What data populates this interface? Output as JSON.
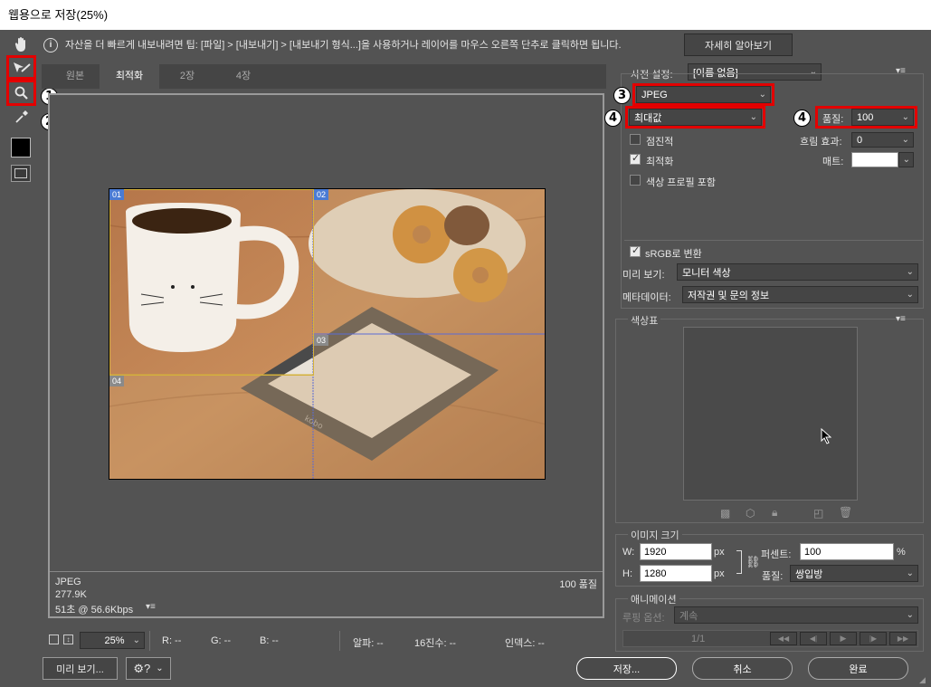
{
  "window": {
    "title": "웹용으로 저장(25%)"
  },
  "tip": {
    "text": "자산을 더 빠르게 내보내려면 팁: [파일] > [내보내기] > [내보내기 형식...]을 사용하거나 레이어를 마우스 오른쪽 단추로 클릭하면 됩니다.",
    "learn_more": "자세히 알아보기"
  },
  "tools": [
    "hand-icon",
    "slice-select-icon",
    "zoom-icon",
    "eyedropper-icon",
    "color-swatch",
    "toggle-slices-icon"
  ],
  "annotations": {
    "b1": "1",
    "b2": "2",
    "b3": "3",
    "b4a": "4",
    "b4b": "4"
  },
  "tabs": [
    {
      "label": "원본"
    },
    {
      "label": "최적화"
    },
    {
      "label": "2장"
    },
    {
      "label": "4장"
    }
  ],
  "slices": {
    "s01": "01",
    "s02": "02",
    "s03": "03",
    "s04": "04"
  },
  "image_info": {
    "format": "JPEG",
    "size": "277.9K",
    "time": "51초 @ 56.6Kbps",
    "quality": "100 품질"
  },
  "preset": {
    "label": "사전 설정:",
    "value": "[이름 없음]",
    "format": "JPEG",
    "quality_level": "최대값",
    "quality_label": "품질:",
    "quality_value": "100",
    "progressive": "점진적",
    "optimized": "최적화",
    "embed_profile": "색상 프로필 포함",
    "blur_label": "흐림 효과:",
    "blur_value": "0",
    "matte_label": "매트:",
    "srgb": "sRGB로 변환",
    "preview_label": "미리 보기:",
    "preview_value": "모니터 색상",
    "metadata_label": "메타데이터:",
    "metadata_value": "저작권 및 문의 정보"
  },
  "color_table": {
    "label": "색상표"
  },
  "image_size": {
    "label": "이미지 크기",
    "w_label": "W:",
    "w_value": "1920",
    "h_label": "H:",
    "h_value": "1280",
    "unit": "px",
    "percent_label": "퍼센트:",
    "percent_value": "100",
    "percent_unit": "%",
    "quality_label": "품질:",
    "quality_value": "쌍입방"
  },
  "animation": {
    "label": "애니메이션",
    "loop_label": "루핑 옵션:",
    "loop_value": "계속",
    "frame": "1/1"
  },
  "status": {
    "zoom": "25%",
    "r": "R: --",
    "g": "G: --",
    "b": "B: --",
    "alpha": "알파: --",
    "hex": "16진수: --",
    "index": "인덱스: --"
  },
  "buttons": {
    "preview": "미리 보기...",
    "save": "저장...",
    "cancel": "취소",
    "done": "완료"
  }
}
